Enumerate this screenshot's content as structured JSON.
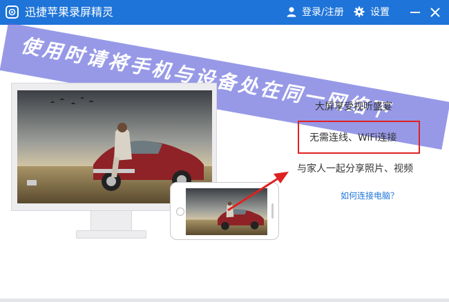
{
  "window": {
    "title": "迅捷苹果录屏精灵",
    "login_label": "登录/注册",
    "settings_label": "设置"
  },
  "banner": {
    "text": "使用时请将手机与设备处在同一网络下"
  },
  "features": {
    "item1": "大屏享受视听盛宴",
    "item2": "无需连线、WiFi连接",
    "item3": "与家人一起分享照片、视频"
  },
  "link": {
    "how_to_connect": "如何连接电脑？"
  },
  "colors": {
    "titlebar": "#1e74d8",
    "banner": "#6062da",
    "highlight": "#e02020",
    "link": "#1e74d8"
  }
}
